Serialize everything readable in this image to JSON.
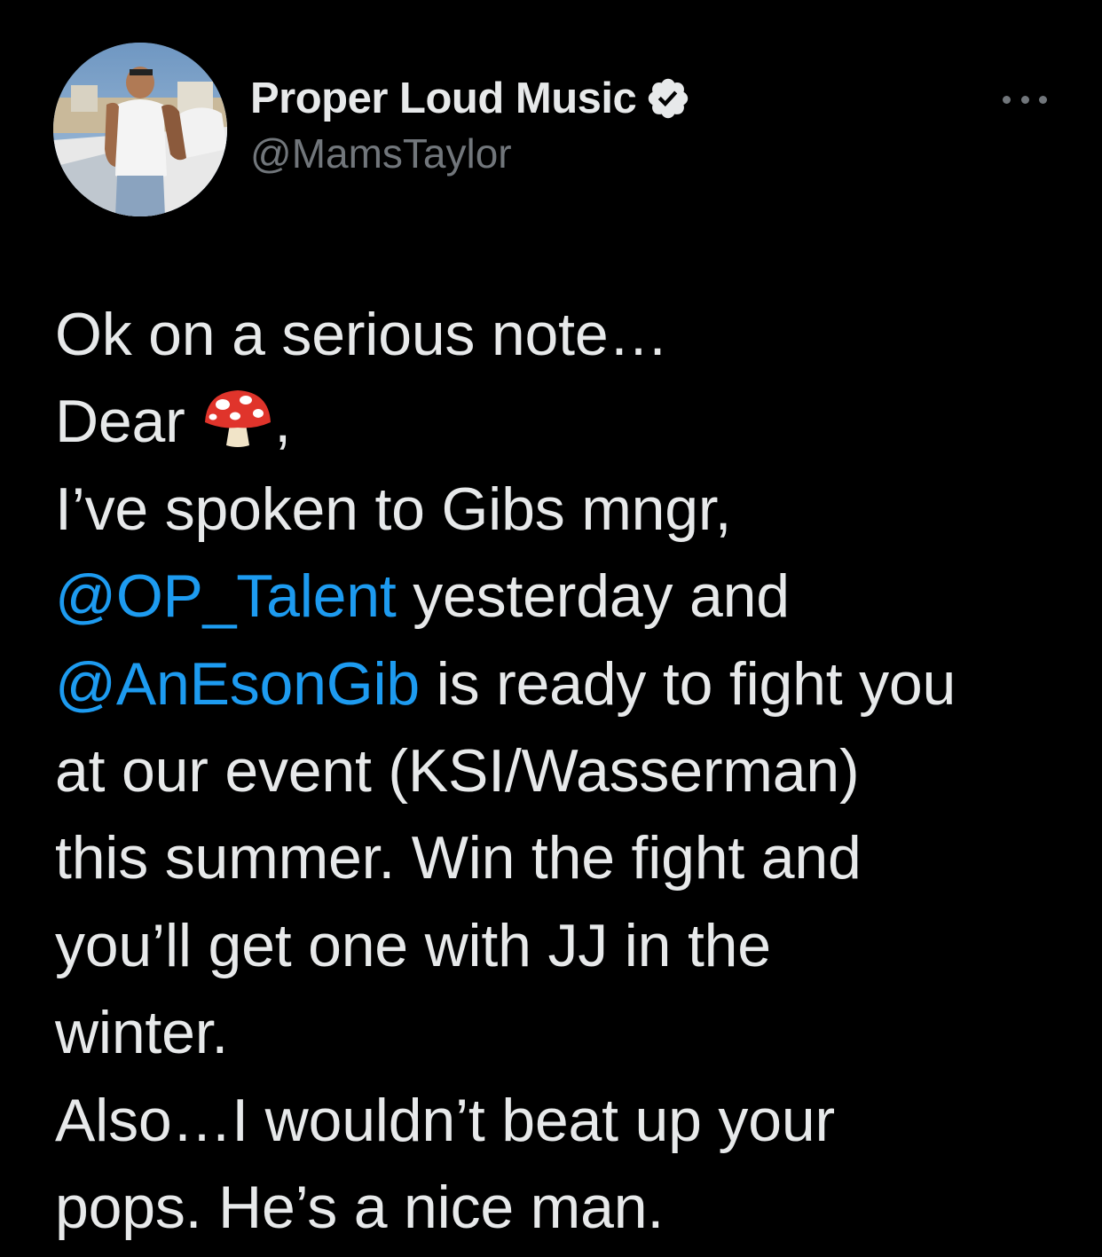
{
  "author": {
    "display_name": "Proper Loud Music",
    "handle": "@MamsTaylor",
    "verified": true,
    "avatar_icon": "avatar-photo"
  },
  "menu": {
    "icon": "more-options-icon"
  },
  "tweet": {
    "line1": "Ok on a serious note…",
    "line2_prefix": "Dear ",
    "line2_emoji": "mushroom-emoji",
    "line2_suffix": ",",
    "line3": "I’ve spoken to Gibs mngr,",
    "line4_mention": "@OP_Talent",
    "line4_rest": " yesterday and",
    "line5_mention": "@AnEsonGib",
    "line5_rest": " is ready to fight you",
    "line6": "at our event (KSI/Wasserman)",
    "line7": "this summer. Win the fight and",
    "line8": "you’ll get one with JJ in the",
    "line9": "winter.",
    "line10": "Also…I wouldn’t beat up your",
    "line11": "pops. He’s a nice man."
  },
  "colors": {
    "background": "#000000",
    "text": "#e7e9ea",
    "secondary": "#71767b",
    "link": "#1d9bf0"
  }
}
